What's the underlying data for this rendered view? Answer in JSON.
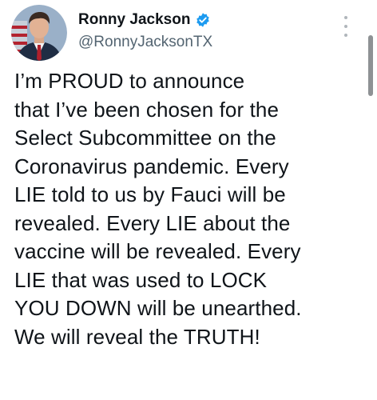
{
  "tweet": {
    "author": {
      "display_name": "Ronny Jackson",
      "handle": "@RonnyJacksonTX",
      "verified": true
    },
    "text_lines": [
      "I’m PROUD to announce",
      "that I’ve been chosen for the",
      "Select Subcommittee on the",
      "Coronavirus pandemic. Every",
      "LIE told to us by Fauci will be",
      "revealed. Every LIE about the",
      "vaccine will be revealed. Every",
      "LIE that was used to LOCK",
      "YOU DOWN will be unearthed.",
      "We will reveal the TRUTH!"
    ]
  },
  "icons": {
    "verified": "verified-badge-icon",
    "more": "more-options-icon"
  },
  "colors": {
    "text": "#0f1419",
    "secondary_text": "#536471",
    "verified_blue": "#1d9bf0"
  }
}
